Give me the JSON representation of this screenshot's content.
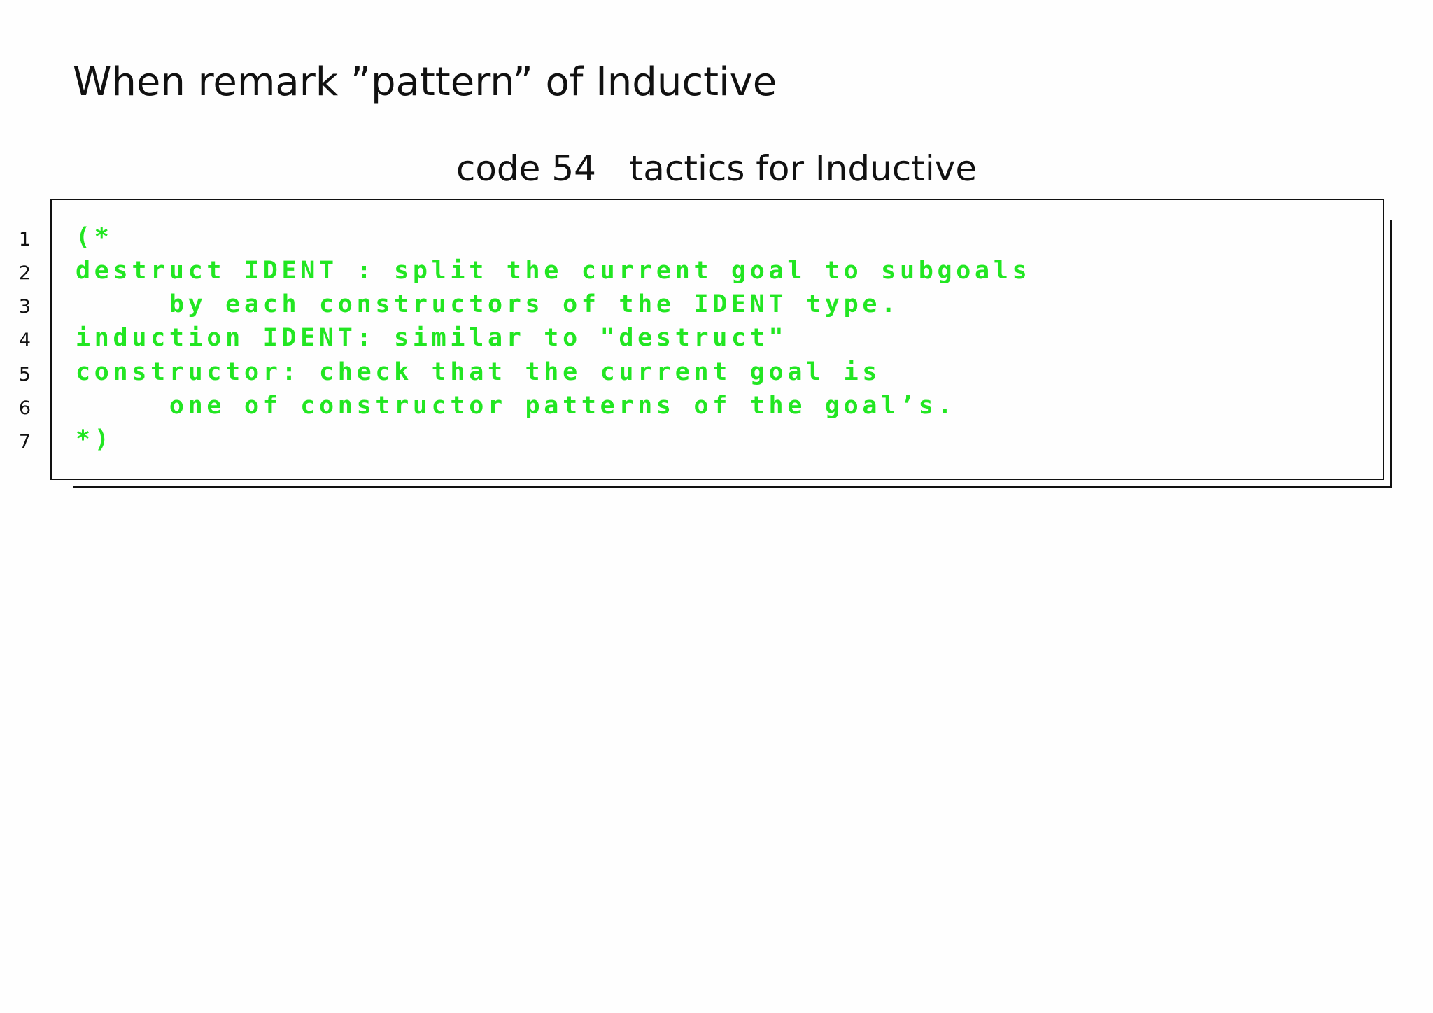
{
  "slide": {
    "title": "When remark ”pattern” of Inductive"
  },
  "code_block": {
    "caption": "code 54   tactics for Inductive",
    "text_color": "#22e622",
    "lines": [
      {
        "number": "1",
        "text": "(*"
      },
      {
        "number": "2",
        "text": "destruct IDENT : split the current goal to subgoals"
      },
      {
        "number": "3",
        "text": "     by each constructors of the IDENT type."
      },
      {
        "number": "4",
        "text": "induction IDENT: similar to \"destruct\""
      },
      {
        "number": "5",
        "text": "constructor: check that the current goal is"
      },
      {
        "number": "6",
        "text": "     one of constructor patterns of the goal’s."
      },
      {
        "number": "7",
        "text": "*)"
      }
    ]
  }
}
